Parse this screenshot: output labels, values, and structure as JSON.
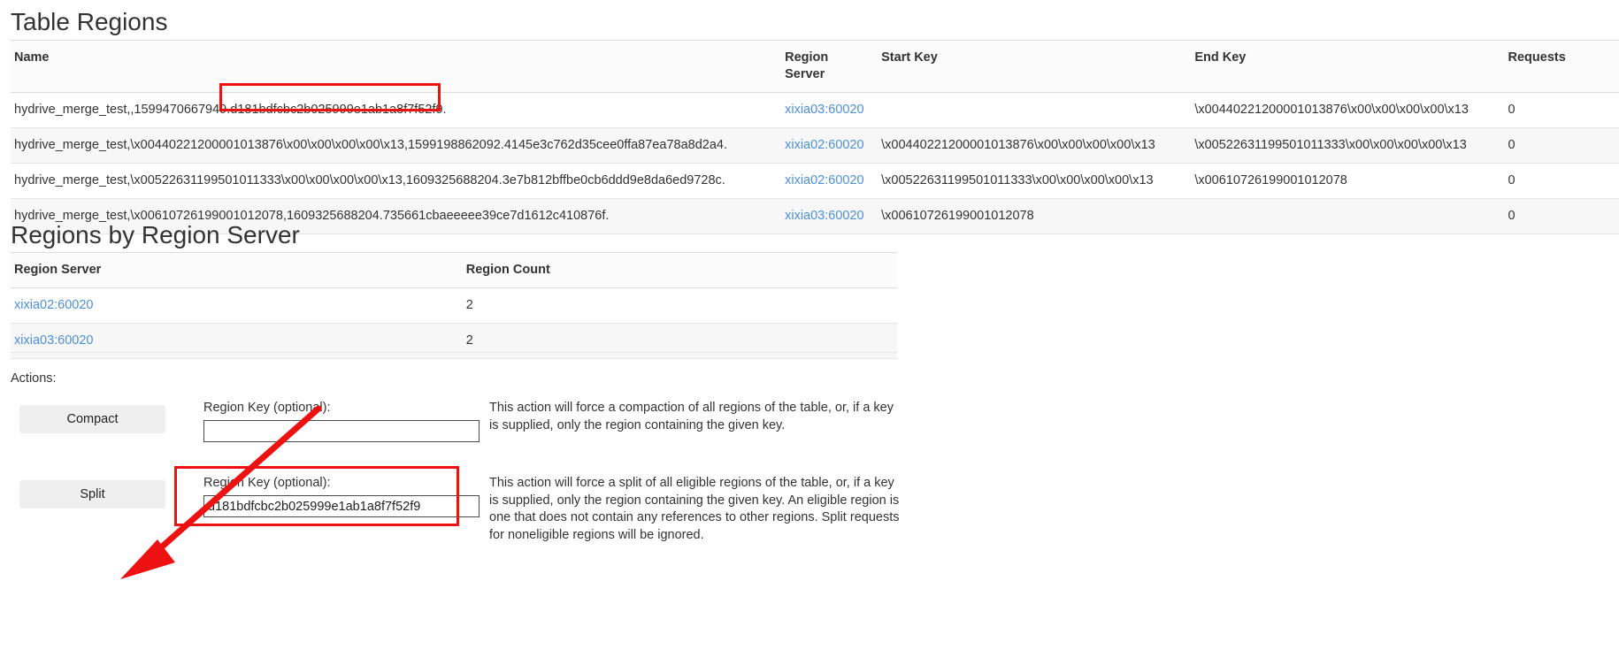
{
  "page": {
    "table_regions_heading": "Table Regions",
    "regions_by_server_heading": "Regions by Region Server",
    "actions_label": "Actions:"
  },
  "table_regions": {
    "columns": {
      "name": "Name",
      "region_server": "Region Server",
      "start_key": "Start Key",
      "end_key": "End Key",
      "requests": "Requests"
    },
    "rows": [
      {
        "name": "hydrive_merge_test,,1599470667949.d181bdfcbc2b025999e1ab1a8f7f52f9.",
        "region_server": "xixia03:60020",
        "start_key": "",
        "end_key": "\\x00440221200001013876\\x00\\x00\\x00\\x00\\x13",
        "requests": "0"
      },
      {
        "name": "hydrive_merge_test,\\x00440221200001013876\\x00\\x00\\x00\\x00\\x13,1599198862092.4145e3c762d35cee0ffa87ea78a8d2a4.",
        "region_server": "xixia02:60020",
        "start_key": "\\x00440221200001013876\\x00\\x00\\x00\\x00\\x13",
        "end_key": "\\x00522631199501011333\\x00\\x00\\x00\\x00\\x13",
        "requests": "0"
      },
      {
        "name": "hydrive_merge_test,\\x00522631199501011333\\x00\\x00\\x00\\x00\\x13,1609325688204.3e7b812bffbe0cb6ddd9e8da6ed9728c.",
        "region_server": "xixia02:60020",
        "start_key": "\\x00522631199501011333\\x00\\x00\\x00\\x00\\x13",
        "end_key": "\\x00610726199001012078",
        "requests": "0"
      },
      {
        "name": "hydrive_merge_test,\\x00610726199001012078,1609325688204.735661cbaeeeee39ce7d1612c410876f.",
        "region_server": "xixia03:60020",
        "start_key": "\\x00610726199001012078",
        "end_key": "",
        "requests": "0"
      }
    ]
  },
  "regions_by_server": {
    "columns": {
      "region_server": "Region Server",
      "region_count": "Region Count"
    },
    "rows": [
      {
        "region_server": "xixia02:60020",
        "region_count": "2"
      },
      {
        "region_server": "xixia03:60020",
        "region_count": "2"
      }
    ]
  },
  "actions": [
    {
      "button_label": "Compact",
      "field_label": "Region Key (optional):",
      "field_value": "",
      "field_placeholder": "",
      "description": "This action will force a compaction of all regions of the table, or, if a key is supplied, only the region containing the given key."
    },
    {
      "button_label": "Split",
      "field_label": "Region Key (optional):",
      "field_value": "d181bdfcbc2b025999e1ab1a8f7f52f9",
      "field_placeholder": "",
      "description": "This action will force a split of all eligible regions of the table, or, if a key is supplied, only the region containing the given key. An eligible region is one that does not contain any references to other regions. Split requests for noneligible regions will be ignored."
    }
  ],
  "annotations": {
    "highlight_color": "#ee1111",
    "arrow_color": "#ee1111",
    "boxes": [
      {
        "name": "region-encoded-name-highlight"
      },
      {
        "name": "split-region-key-highlight"
      }
    ],
    "arrow": {
      "name": "pointer-to-split-button"
    }
  }
}
